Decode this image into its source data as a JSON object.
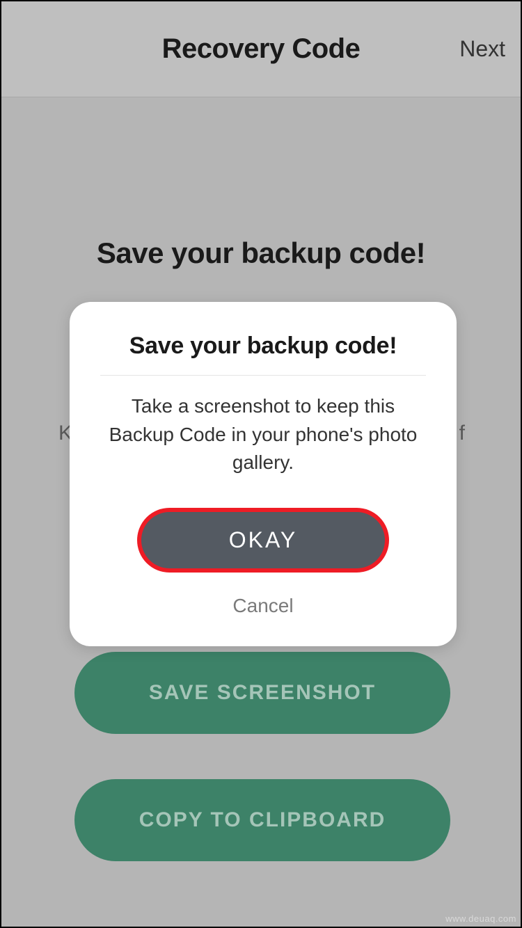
{
  "header": {
    "title": "Recovery Code",
    "next": "Next"
  },
  "page": {
    "heading": "Save your backup code!",
    "hint_left": "K",
    "hint_right": "f",
    "save_screenshot": "SAVE SCREENSHOT",
    "copy_clipboard": "COPY TO CLIPBOARD"
  },
  "modal": {
    "title": "Save your backup code!",
    "body": "Take a screenshot to keep this Backup Code in your phone's photo gallery.",
    "okay": "OKAY",
    "cancel": "Cancel"
  },
  "watermark": "www.deuaq.com"
}
